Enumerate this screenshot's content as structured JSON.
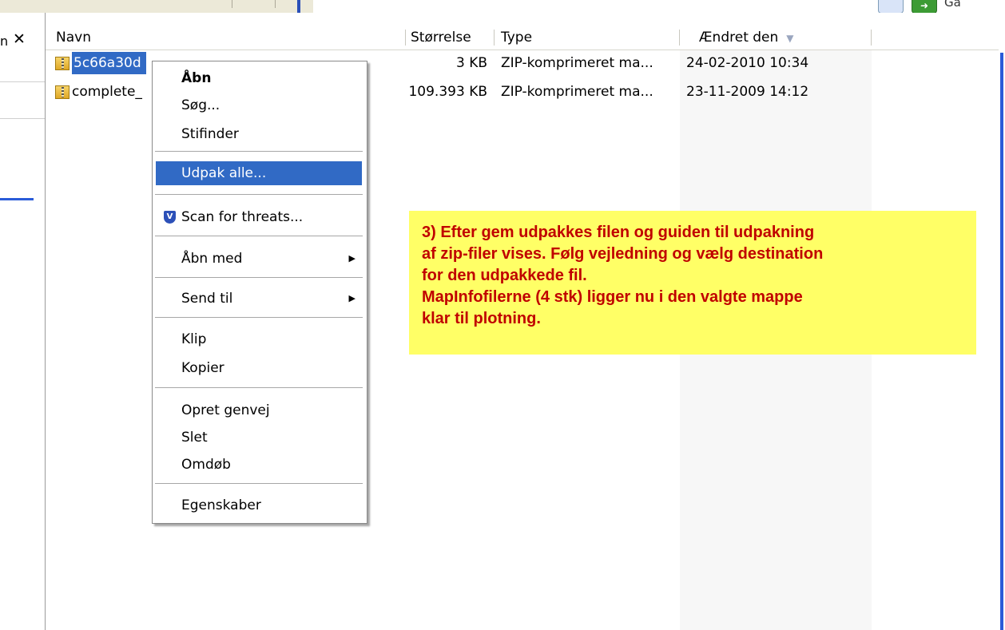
{
  "top_bar": {
    "go_label": "Gå"
  },
  "left_pane": {
    "close_label": "✕",
    "fragment": "n"
  },
  "columns": [
    {
      "label": "Navn"
    },
    {
      "label": "Størrelse"
    },
    {
      "label": "Type"
    },
    {
      "label": "Ændret den"
    }
  ],
  "sort_indicator": "▼",
  "files": [
    {
      "name": "5c66a30d",
      "size": "3 KB",
      "type": "ZIP-komprimeret ma...",
      "modified": "24-02-2010 10:34"
    },
    {
      "name": "complete_",
      "size": "109.393 KB",
      "type": "ZIP-komprimeret ma...",
      "modified": "23-11-2009 14:12"
    }
  ],
  "context_menu": {
    "items": [
      {
        "label": "Åbn"
      },
      {
        "label": "Søg..."
      },
      {
        "label": "Stifinder"
      },
      {
        "label": "Udpak alle..."
      },
      {
        "label": "Scan for threats..."
      },
      {
        "label": "Åbn med"
      },
      {
        "label": "Send til"
      },
      {
        "label": "Klip"
      },
      {
        "label": "Kopier"
      },
      {
        "label": "Opret genvej"
      },
      {
        "label": "Slet"
      },
      {
        "label": "Omdøb"
      },
      {
        "label": "Egenskaber"
      }
    ],
    "shield_glyph": "V"
  },
  "annotation": {
    "lines": [
      "3) Efter gem udpakkes filen og guiden til udpakning",
      "af zip-filer vises. Følg vejledning og vælg destination",
      "for den udpakkede fil.",
      "MapInfofilerne (4 stk) ligger nu i den valgte mappe",
      "klar til plotning."
    ],
    "color": "#c00000",
    "background": "#ffff66"
  },
  "colors": {
    "selection": "#316ac5",
    "accent_blue": "#2a5bd8"
  }
}
